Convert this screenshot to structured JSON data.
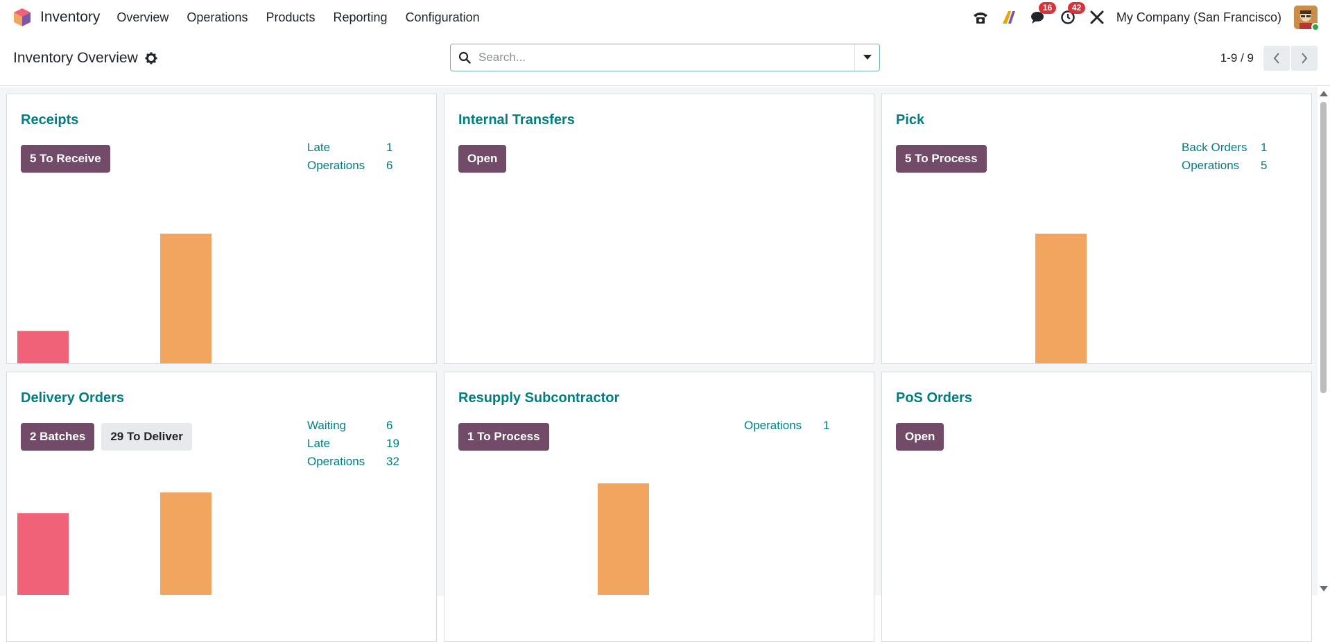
{
  "navbar": {
    "app_name": "Inventory",
    "menu": [
      "Overview",
      "Operations",
      "Products",
      "Reporting",
      "Configuration"
    ],
    "chat_badge": "16",
    "activity_badge": "42",
    "company": "My Company (San Francisco)",
    "icons": [
      "phone-icon",
      "ai-icon",
      "chat-icon",
      "clock-icon",
      "tools-icon"
    ]
  },
  "control": {
    "title": "Inventory Overview",
    "search_placeholder": "Search...",
    "pager": "1-9 / 9"
  },
  "cards": [
    {
      "title": "Receipts",
      "buttons": [
        {
          "label": "5 To Receive",
          "style": "primary"
        }
      ],
      "stats": [
        {
          "label": "Late",
          "value": "1"
        },
        {
          "label": "Operations",
          "value": "6"
        }
      ],
      "bars": [
        {
          "value": 0.25,
          "color": "#ef6278"
        },
        {
          "value": 1.0,
          "color": "#f2a55f"
        }
      ]
    },
    {
      "title": "Internal Transfers",
      "buttons": [
        {
          "label": "Open",
          "style": "primary"
        }
      ],
      "stats": [],
      "bars": []
    },
    {
      "title": "Pick",
      "buttons": [
        {
          "label": "5 To Process",
          "style": "primary"
        }
      ],
      "stats": [
        {
          "label": "Back Orders",
          "value": "1"
        },
        {
          "label": "Operations",
          "value": "5"
        }
      ],
      "bars": [
        {
          "value": 0,
          "color": "#ef6278"
        },
        {
          "value": 1.0,
          "color": "#f2a55f"
        }
      ]
    },
    {
      "title": "Delivery Orders",
      "buttons": [
        {
          "label": "2 Batches",
          "style": "primary"
        },
        {
          "label": "29 To Deliver",
          "style": "secondary"
        }
      ],
      "stats": [
        {
          "label": "Waiting",
          "value": "6"
        },
        {
          "label": "Late",
          "value": "19"
        },
        {
          "label": "Operations",
          "value": "32"
        }
      ],
      "bars": [
        {
          "value": 0.63,
          "color": "#ef6278"
        },
        {
          "value": 0.79,
          "color": "#f2a55f"
        }
      ]
    },
    {
      "title": "Resupply Subcontractor",
      "buttons": [
        {
          "label": "1 To Process",
          "style": "primary"
        }
      ],
      "stats": [
        {
          "label": "Operations",
          "value": "1"
        }
      ],
      "bars": [
        {
          "value": 0,
          "color": "#ef6278"
        },
        {
          "value": 0.86,
          "color": "#f2a55f"
        }
      ]
    },
    {
      "title": "PoS Orders",
      "buttons": [
        {
          "label": "Open",
          "style": "primary"
        }
      ],
      "stats": [],
      "bars": []
    }
  ]
}
